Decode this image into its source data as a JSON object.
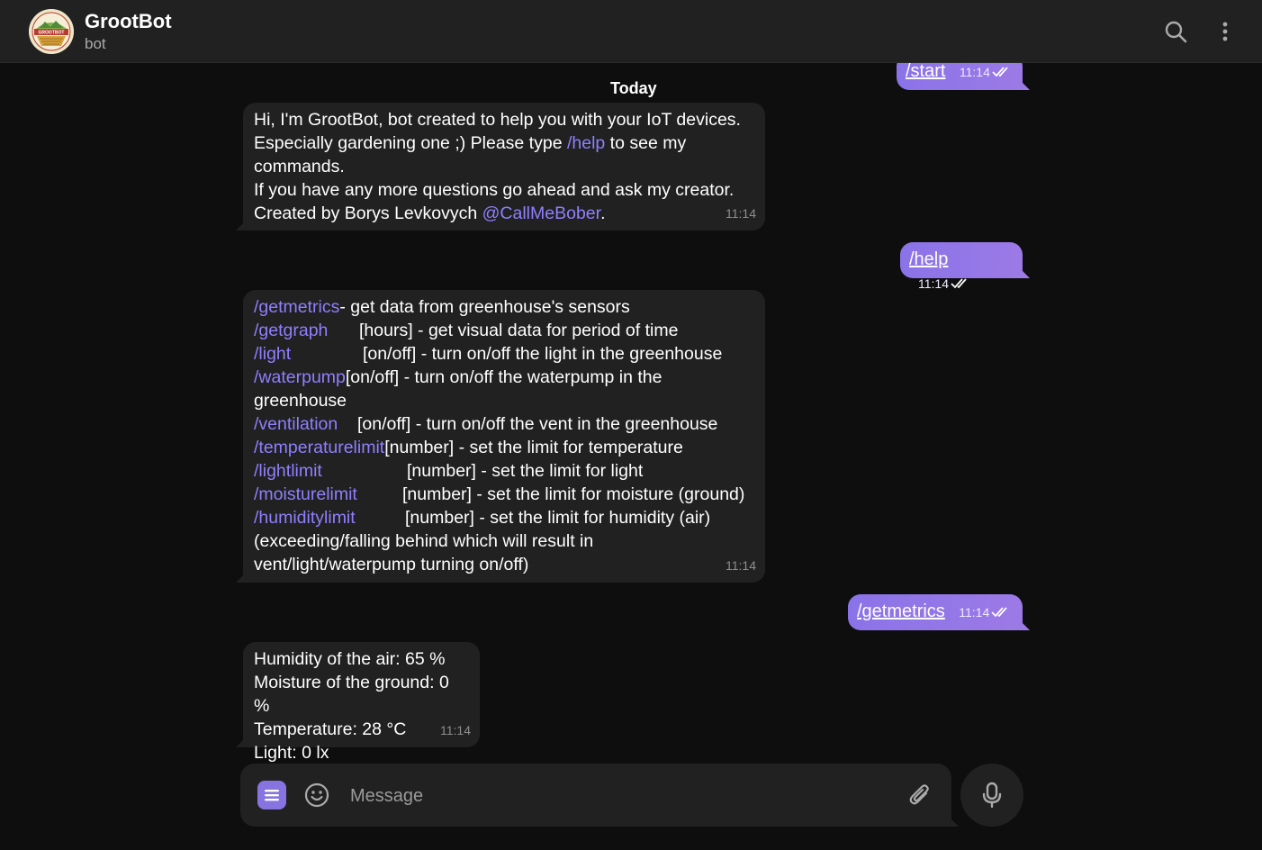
{
  "header": {
    "title": "GrootBot",
    "subtitle": "bot",
    "avatar_text": "GROOTBOT"
  },
  "date_separator": "Today",
  "messages": {
    "start": {
      "text": "/start",
      "time": "11:14"
    },
    "welcome": {
      "line1": "Hi, I'm GrootBot, bot created to help you with your IoT devices.",
      "line2_a": "Especially gardening one ;) Please type ",
      "line2_link": "/help",
      "line2_b": " to see my",
      "line3": "commands.",
      "line4": "If you have any more questions go ahead and ask my creator.",
      "line5_a": "Created by Borys Levkovych ",
      "line5_link": "@CallMeBober",
      "line5_b": ".",
      "time": "11:14"
    },
    "help": {
      "text": "/help",
      "time": "11:14"
    },
    "commands": {
      "items": [
        {
          "cmd": "/getmetrics",
          "desc": " - get data from greenhouse's sensors"
        },
        {
          "cmd": "/getgraph",
          "desc": "[hours] - get visual data for period of time"
        },
        {
          "cmd": "/light",
          "desc": "[on/off] - turn on/off the light in the greenhouse"
        },
        {
          "cmd": "/waterpump",
          "desc": " [on/off] - turn on/off the waterpump in the"
        },
        {
          "cmd": "/ventilation",
          "desc": "[on/off] - turn on/off the vent in the greenhouse"
        },
        {
          "cmd": "/temperaturelimit",
          "desc": " [number] - set the limit for temperature"
        },
        {
          "cmd": "/lightlimit",
          "desc": "[number] - set the limit for light"
        },
        {
          "cmd": "/moisturelimit",
          "desc": "[number] - set the limit for moisture (ground)"
        },
        {
          "cmd": "/humiditylimit",
          "desc": "[number] - set the limit for humidity (air)"
        }
      ],
      "waterpump_cont": "greenhouse",
      "footer1": "(exceeding/falling behind which will result in",
      "footer2": "vent/light/waterpump turning on/off)",
      "time": "11:14"
    },
    "getmetrics": {
      "text": "/getmetrics",
      "time": "11:14"
    },
    "metrics": {
      "humidity": "Humidity of the air: 65 %",
      "moisture": "Moisture of the ground: 0 %",
      "temperature": "Temperature: 28 °C",
      "light": "Light: 0 lx",
      "time": "11:14"
    }
  },
  "composer": {
    "placeholder": "Message"
  },
  "colors": {
    "accent": "#8774e1",
    "link": "#8f7fff",
    "bubble_in": "#212121",
    "background": "#0e0e0e"
  },
  "icons": {
    "search": "search-icon",
    "menu": "more-vertical-icon",
    "bot_menu": "bot-menu-icon",
    "emoji": "emoji-icon",
    "attach": "paperclip-icon",
    "mic": "microphone-icon",
    "read": "double-check-icon"
  }
}
